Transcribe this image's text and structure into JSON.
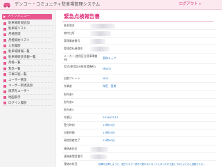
{
  "app": {
    "title": "デンコー・コミュニティ駐車場管理システム",
    "logout": "ログアウト »"
  },
  "sidebar": {
    "header": "メインメニュー",
    "items": [
      {
        "label": "駐車場新規追加"
      },
      {
        "label": "駐車場リスト"
      },
      {
        "label": "月極管理"
      },
      {
        "label": "月極契約リスト"
      },
      {
        "label": "入金履歴"
      },
      {
        "label": "駐車場情報一覧"
      },
      {
        "label": "駐車場統計情報一覧"
      },
      {
        "label": "月極一覧"
      },
      {
        "label": "緊急一覧"
      },
      {
        "label": "工事日程一覧"
      },
      {
        "label": "ユーザー管理"
      },
      {
        "label": "ユーザー新規追加"
      },
      {
        "label": "請求先ユーザー"
      },
      {
        "label": "地図表示"
      },
      {
        "label": "ログイン履歴"
      }
    ]
  },
  "main": {
    "title": "緊急点検報告書",
    "fields": [
      {
        "label": "駐車場名",
        "value": ""
      },
      {
        "label": "物件住所",
        "value": ""
      },
      {
        "label": "管理業者番号",
        "value": ""
      },
      {
        "label": "管理会社連絡先",
        "value": ""
      },
      {
        "label": "メーカー(使用区分駐車場機材)",
        "value": "東和テック"
      },
      {
        "label": "型式(使用区分駐車場機材)",
        "value": "MAXQ"
      },
      {
        "label": "自動プレート",
        "value": "NO3"
      },
      {
        "label": "作業者",
        "value": "岸田　直美"
      },
      {
        "label": "指令者1",
        "value": ""
      },
      {
        "label": "指令者2",
        "value": ""
      },
      {
        "label": "指令者3",
        "value": ""
      },
      {
        "label": "作業日",
        "value": "2016/07/13"
      },
      {
        "label": "受付時刻",
        "value": "13時35分"
      },
      {
        "label": "出動時間",
        "value": "13時55分"
      },
      {
        "label": "現地到着完了",
        "value": "14時00分"
      },
      {
        "label": "連絡者氏名",
        "value": ""
      },
      {
        "label": "連絡者電話番号",
        "value": ""
      },
      {
        "label": "連絡の状況",
        "value": "駐車を出庫しようと、過ぎてエラー表示で動かなくなってしまったので直してほしいとのご連絡でした。"
      }
    ]
  }
}
